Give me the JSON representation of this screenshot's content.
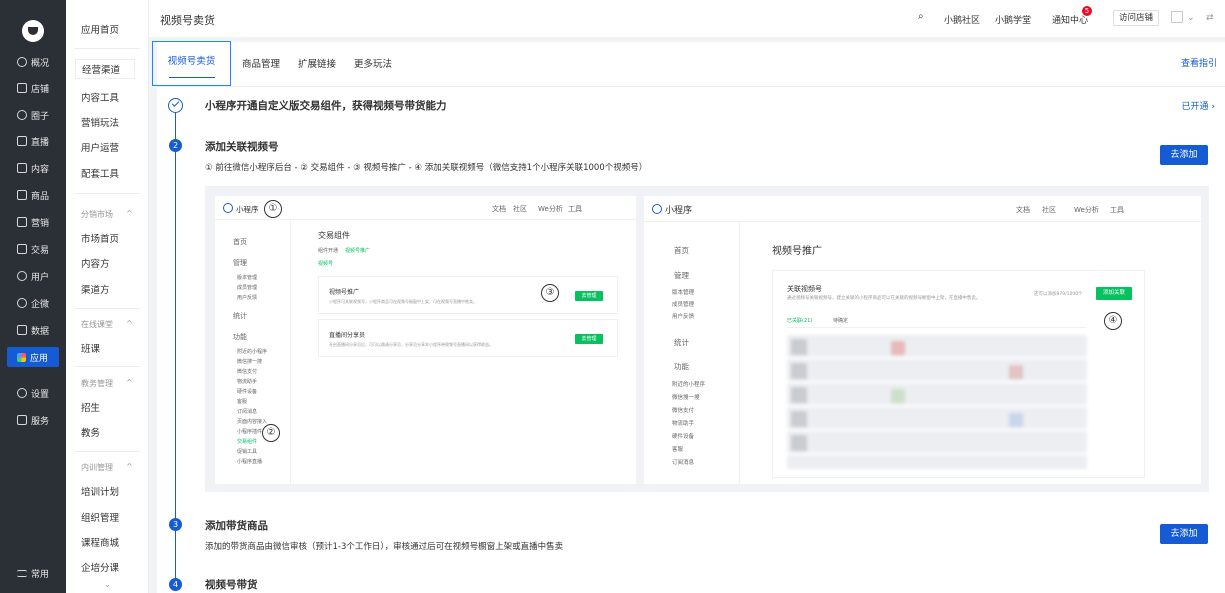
{
  "rail": {
    "items": [
      {
        "label": "概况",
        "icon": "overview-icon"
      },
      {
        "label": "店铺",
        "icon": "store-icon"
      },
      {
        "label": "圈子",
        "icon": "circle-icon"
      },
      {
        "label": "直播",
        "icon": "live-icon"
      },
      {
        "label": "内容",
        "icon": "content-icon"
      },
      {
        "label": "商品",
        "icon": "goods-icon"
      },
      {
        "label": "营销",
        "icon": "marketing-icon"
      },
      {
        "label": "交易",
        "icon": "trade-icon"
      },
      {
        "label": "用户",
        "icon": "user-icon"
      },
      {
        "label": "企微",
        "icon": "wecom-icon"
      },
      {
        "label": "数据",
        "icon": "data-icon"
      },
      {
        "label": "应用",
        "icon": "apps-icon"
      },
      {
        "label": "设置",
        "icon": "settings-icon"
      },
      {
        "label": "服务",
        "icon": "service-icon"
      }
    ],
    "bottom": "常用",
    "bottom_icon": "menu-icon",
    "active": "应用"
  },
  "secondary": {
    "home": "应用首页",
    "items1": [
      "经营渠道",
      "内容工具",
      "营销玩法",
      "用户运营",
      "配套工具"
    ],
    "group_market": "分销市场",
    "items2": [
      "市场首页",
      "内容方",
      "渠道方"
    ],
    "group_online": "在线课堂",
    "items3": [
      "班课"
    ],
    "group_edu": "教务管理",
    "items4": [
      "招生",
      "教务"
    ],
    "group_train": "内训管理",
    "items5": [
      "培训计划",
      "组织管理",
      "课程商城",
      "企培分课"
    ],
    "active": "经营渠道"
  },
  "topbar": {
    "title": "视频号卖货",
    "community": "小鹅社区",
    "school": "小鹅学堂",
    "notice": "通知中心",
    "notice_count": "5",
    "visit_store": "访问店铺",
    "search_icon": "search-icon"
  },
  "tabs": [
    "视频号卖货",
    "商品管理",
    "扩展链接",
    "更多玩法"
  ],
  "guide": "查看指引",
  "steps": {
    "s1": {
      "title": "小程序开通自定义版交易组件，获得视频号带货能力",
      "status": "已开通 ›"
    },
    "s2": {
      "num": "2",
      "title": "添加关联视频号",
      "desc": "① 前往微信小程序后台 - ② 交易组件 - ③ 视频号推广 - ④ 添加关联视频号（微信支持1个小程序关联1000个视频号）",
      "button": "去添加"
    },
    "s3": {
      "num": "3",
      "title": "添加带货商品",
      "desc": "添加的带货商品由微信审核（预计1-3个工作日），审核通过后可在视频号橱窗上架或直播中售卖",
      "button": "去添加"
    },
    "s4": {
      "num": "4",
      "title": "视频号带货"
    }
  },
  "preview": {
    "left": {
      "brand": "小程序",
      "nav": [
        "文档",
        "社区",
        "We分析",
        "工具"
      ],
      "side": [
        "首页",
        "管理",
        "统计",
        "功能"
      ],
      "side_sub": [
        "版本管理",
        "成员管理",
        "用户反馈"
      ],
      "side_sub2": [
        "附近的小程序",
        "微信搜一搜",
        "微信支付",
        "物流助手",
        "硬件设备",
        "客服",
        "订阅消息",
        "页面内容接入",
        "小程序插件",
        "交易组件",
        "促销工具",
        "小程序直播"
      ],
      "title": "交易组件",
      "subtabs": [
        "组件开通",
        "视频号推广"
      ],
      "chip": "视频号",
      "box1_title": "视频号推广",
      "box1_text": "小程序可关联视频号，小程序商品可在视频号橱窗中上架，可在视频号直播中售卖。",
      "box2_title": "直播间分享员",
      "box2_text": "开启直播间分享员后，可可以邀请分享员，分享员分享本小程序带视频号直播间以获得收益。",
      "btn": "去管理",
      "markers": [
        "①",
        "②",
        "③"
      ]
    },
    "right": {
      "brand": "小程序",
      "nav": [
        "文档",
        "社区",
        "We分析",
        "工具"
      ],
      "side": [
        "首页",
        "管理",
        "统计",
        "功能"
      ],
      "side_sub": [
        "版本管理",
        "成员管理",
        "用户反馈"
      ],
      "side_sub2": [
        "附近的小程序",
        "微信搜一搜",
        "微信支付",
        "物流助手",
        "硬件设备",
        "客服",
        "订阅消息"
      ],
      "title": "视频号推广",
      "box_title": "关联视频号",
      "box_text": "通过视频号关联视频号，建立关联的小程序商品可以在关联的视频号橱窗中上架，在直播中售卖。",
      "limit": "还可以添加979/1000个",
      "btn": "添加关联",
      "tabs": [
        "已关联(21)",
        "待确定"
      ],
      "marker": "④"
    }
  }
}
